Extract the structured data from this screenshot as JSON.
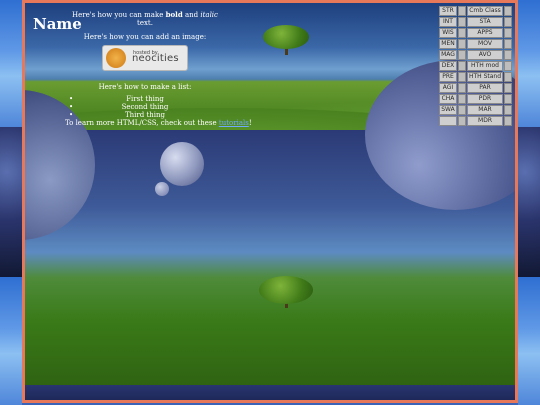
{
  "page": {
    "title": "Name",
    "line1_pre": "Here's how you can make ",
    "line1_bold": "bold",
    "line1_mid": " and ",
    "line1_italic": "italic",
    "line1_post": " text.",
    "line2": "Here's how you can add an image:",
    "badge_small": "hosted by",
    "badge_big": "neocities",
    "list_intro": "Here's how to make a list:",
    "list_items": [
      "First thing",
      "Second thing",
      "Third thing"
    ],
    "footer_pre": "To learn more HTML/CSS, check out these ",
    "footer_link": "tutorials",
    "footer_post": "!"
  },
  "grid": {
    "left": [
      "STR",
      "INT",
      "WIS",
      "MEN",
      "MAG",
      "DEX",
      "PRE",
      "AGI",
      "CHA",
      "SWA",
      ""
    ],
    "right": [
      "Cmb Class",
      "STA",
      "APPS",
      "MOV",
      "AVO",
      "HTH mod",
      "HTH Stand",
      "PAR",
      "PDR",
      "MAR",
      "MDR"
    ]
  },
  "colors": {
    "frame_border": "#e8785a",
    "link": "#6fa8ff"
  }
}
